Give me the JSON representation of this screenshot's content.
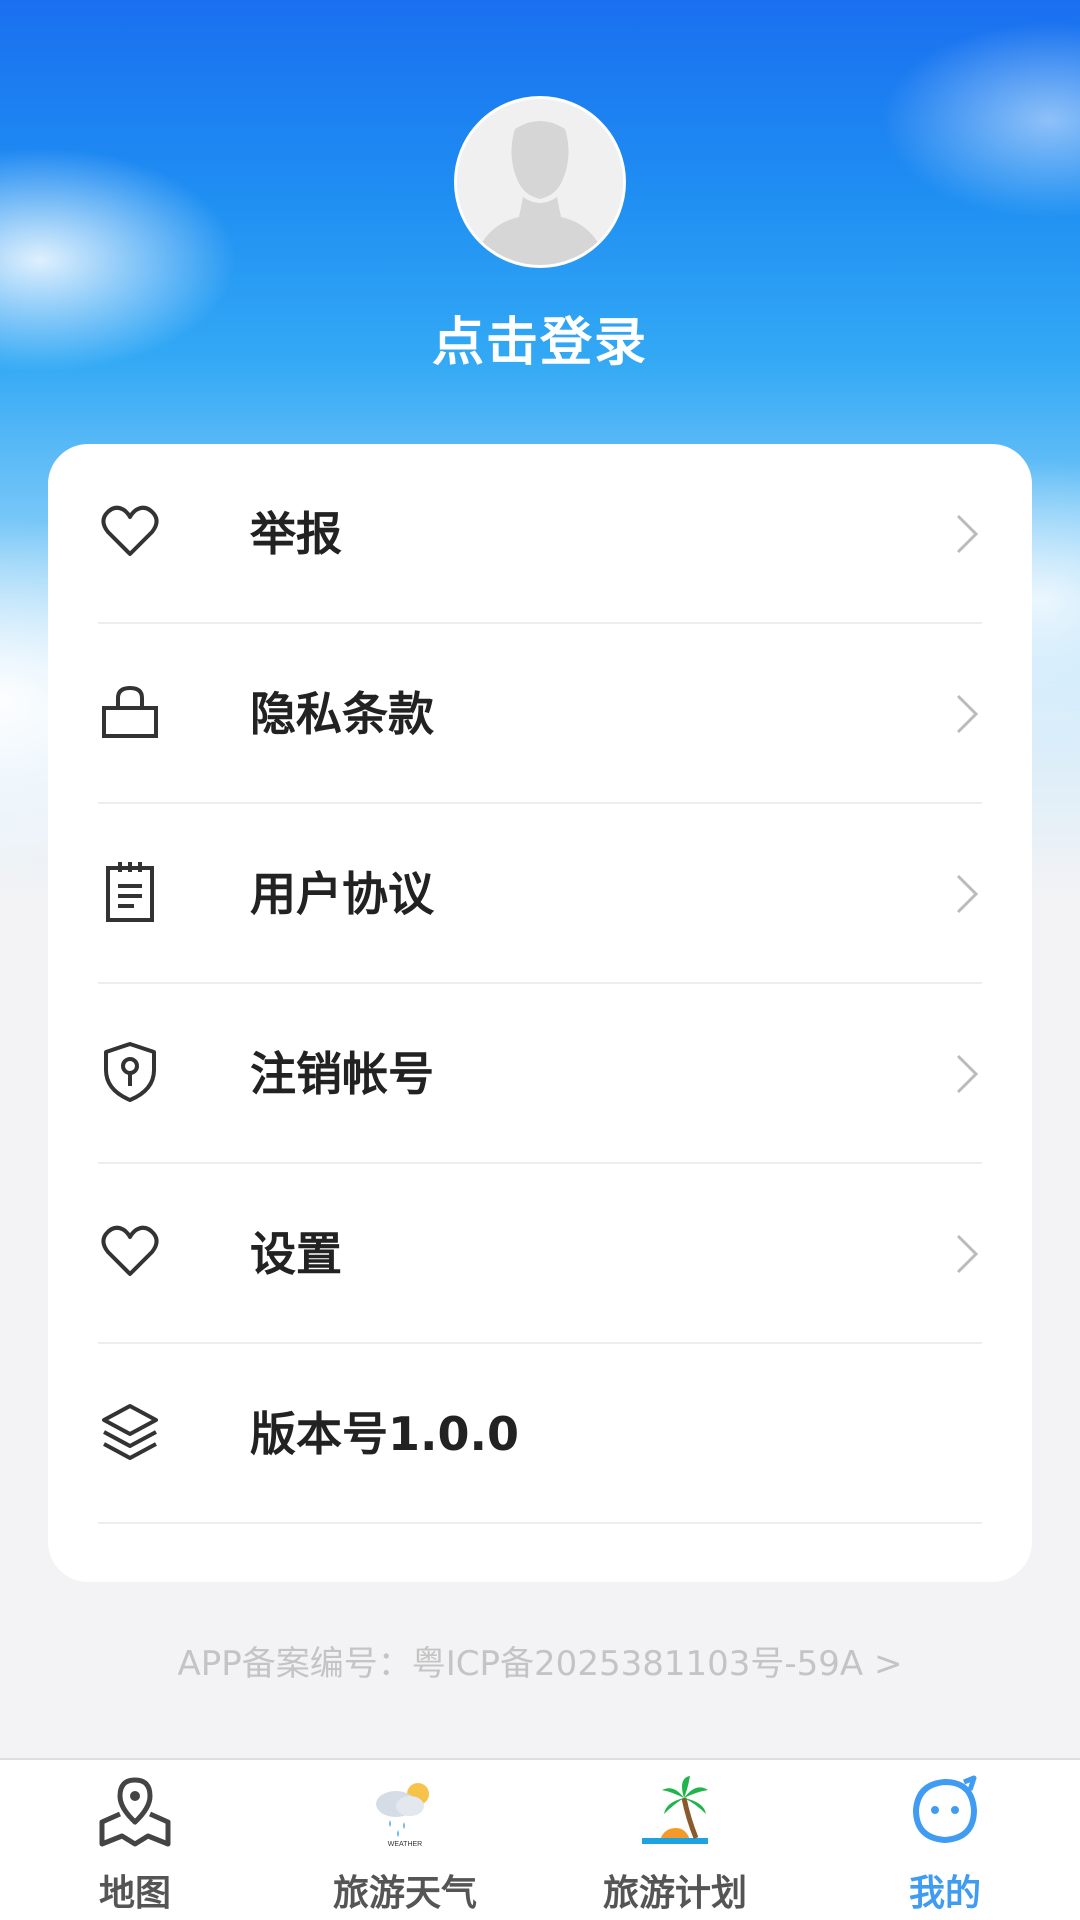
{
  "profile": {
    "login_text": "点击登录"
  },
  "menu": {
    "items": [
      {
        "label": "举报",
        "icon": "heart-icon",
        "has_arrow": true
      },
      {
        "label": "隐私条款",
        "icon": "lock-icon",
        "has_arrow": true
      },
      {
        "label": "用户协议",
        "icon": "notepad-icon",
        "has_arrow": true
      },
      {
        "label": "注销帐号",
        "icon": "shield-icon",
        "has_arrow": true
      },
      {
        "label": "设置",
        "icon": "heart-icon",
        "has_arrow": true
      },
      {
        "label": "版本号1.0.0",
        "icon": "layers-icon",
        "has_arrow": false
      }
    ]
  },
  "icp": {
    "text": "APP备案编号：粤ICP备2025381103号-59A >"
  },
  "tabbar": {
    "active_color": "#3f9cf2",
    "items": [
      {
        "label": "地图",
        "icon": "map-pin-icon",
        "active": false
      },
      {
        "label": "旅游天气",
        "icon": "weather-icon",
        "icon_text": "WEATHER",
        "active": false
      },
      {
        "label": "旅游计划",
        "icon": "palm-tree-icon",
        "active": false
      },
      {
        "label": "我的",
        "icon": "smiley-icon",
        "active": true
      }
    ]
  }
}
